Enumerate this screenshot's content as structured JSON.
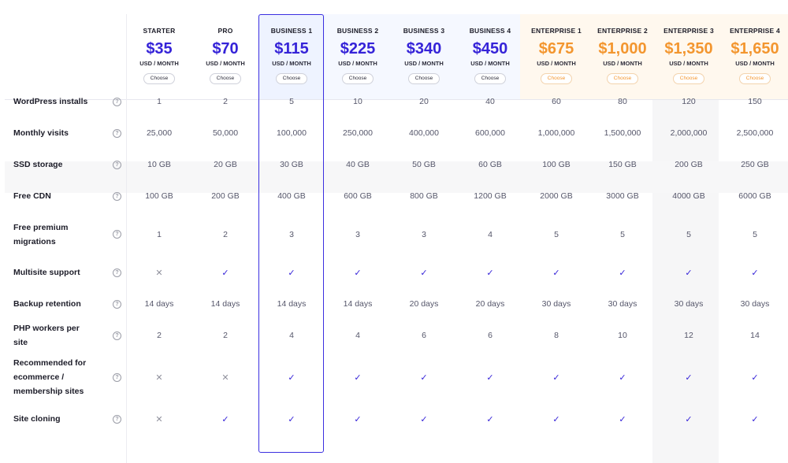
{
  "plans": [
    {
      "name": "STARTER",
      "price": "$35",
      "unit": "USD / MONTH",
      "cta": "Choose",
      "accent": "#3523d8"
    },
    {
      "name": "PRO",
      "price": "$70",
      "unit": "USD / MONTH",
      "cta": "Choose",
      "accent": "#3523d8"
    },
    {
      "name": "BUSINESS 1",
      "price": "$115",
      "unit": "USD / MONTH",
      "cta": "Choose",
      "accent": "#3523d8"
    },
    {
      "name": "BUSINESS 2",
      "price": "$225",
      "unit": "USD / MONTH",
      "cta": "Choose",
      "accent": "#3523d8"
    },
    {
      "name": "BUSINESS 3",
      "price": "$340",
      "unit": "USD / MONTH",
      "cta": "Choose",
      "accent": "#3523d8"
    },
    {
      "name": "BUSINESS 4",
      "price": "$450",
      "unit": "USD / MONTH",
      "cta": "Choose",
      "accent": "#3523d8"
    },
    {
      "name": "ENTERPRISE 1",
      "price": "$675",
      "unit": "USD / MONTH",
      "cta": "Choose",
      "accent": "#f3962f"
    },
    {
      "name": "ENTERPRISE 2",
      "price": "$1,000",
      "unit": "USD / MONTH",
      "cta": "Choose",
      "accent": "#f3962f"
    },
    {
      "name": "ENTERPRISE 3",
      "price": "$1,350",
      "unit": "USD / MONTH",
      "cta": "Choose",
      "accent": "#f3962f"
    },
    {
      "name": "ENTERPRISE 4",
      "price": "$1,650",
      "unit": "USD / MONTH",
      "cta": "Choose",
      "accent": "#f3962f"
    }
  ],
  "features": [
    {
      "label": "WordPress installs",
      "values": [
        "1",
        "2",
        "5",
        "10",
        "20",
        "40",
        "60",
        "80",
        "120",
        "150"
      ]
    },
    {
      "label": "Monthly visits",
      "values": [
        "25,000",
        "50,000",
        "100,000",
        "250,000",
        "400,000",
        "600,000",
        "1,000,000",
        "1,500,000",
        "2,000,000",
        "2,500,000"
      ]
    },
    {
      "label": "SSD storage",
      "values": [
        "10 GB",
        "20 GB",
        "30 GB",
        "40 GB",
        "50 GB",
        "60 GB",
        "100 GB",
        "150 GB",
        "200 GB",
        "250 GB"
      ]
    },
    {
      "label": "Free CDN",
      "values": [
        "100 GB",
        "200 GB",
        "400 GB",
        "600 GB",
        "800 GB",
        "1200 GB",
        "2000 GB",
        "3000 GB",
        "4000 GB",
        "6000 GB"
      ]
    },
    {
      "label": "Free premium migrations",
      "values": [
        "1",
        "2",
        "3",
        "3",
        "3",
        "4",
        "5",
        "5",
        "5",
        "5"
      ]
    },
    {
      "label": "Multisite support",
      "values": [
        "✕",
        "✓",
        "✓",
        "✓",
        "✓",
        "✓",
        "✓",
        "✓",
        "✓",
        "✓"
      ]
    },
    {
      "label": "Backup retention",
      "values": [
        "14 days",
        "14 days",
        "14 days",
        "14 days",
        "20 days",
        "20 days",
        "30 days",
        "30 days",
        "30 days",
        "30 days"
      ]
    },
    {
      "label": "PHP workers per site",
      "values": [
        "2",
        "2",
        "4",
        "4",
        "6",
        "6",
        "8",
        "10",
        "12",
        "14"
      ]
    },
    {
      "label": "Recommended for ecommerce / membership sites",
      "values": [
        "✕",
        "✕",
        "✓",
        "✓",
        "✓",
        "✓",
        "✓",
        "✓",
        "✓",
        "✓"
      ]
    },
    {
      "label": "Site cloning",
      "values": [
        "✕",
        "✓",
        "✓",
        "✓",
        "✓",
        "✓",
        "✓",
        "✓",
        "✓",
        "✓"
      ]
    }
  ],
  "icons": {
    "help": "?"
  },
  "colors": {
    "primary": "#3523d8",
    "enterprise": "#f3962f",
    "highlight_border": "#3b2fe0"
  }
}
